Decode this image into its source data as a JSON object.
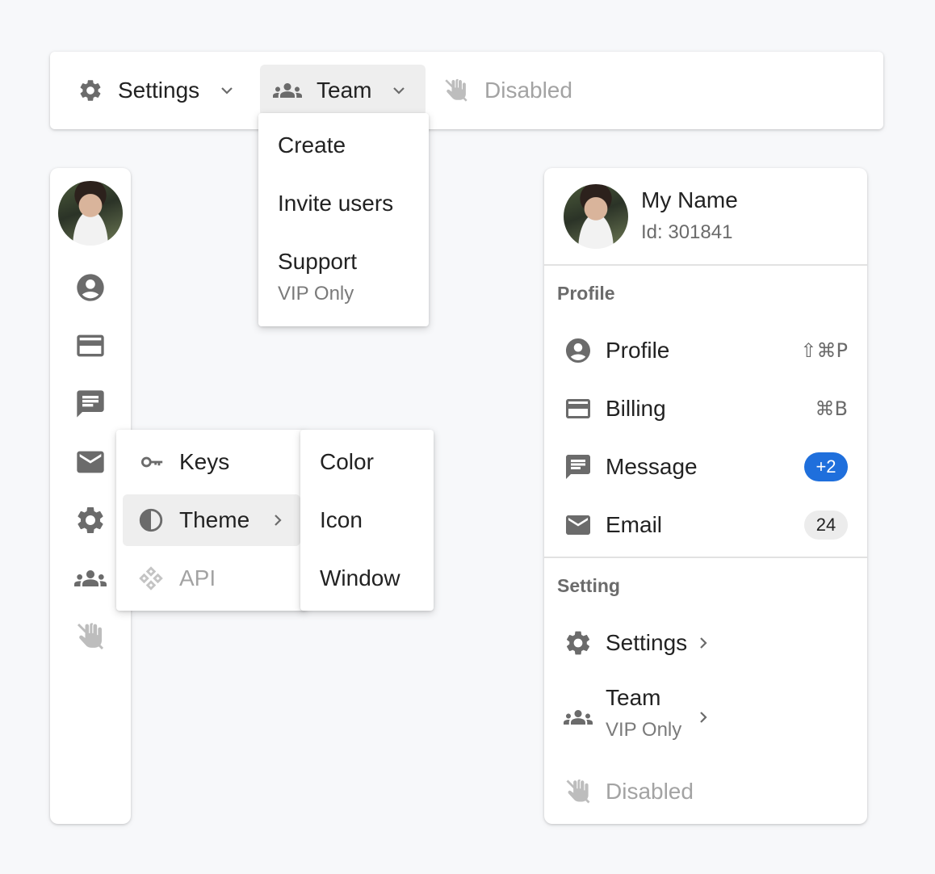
{
  "menubar": {
    "settings_label": "Settings",
    "team_label": "Team",
    "disabled_label": "Disabled"
  },
  "team_dropdown": {
    "items": [
      {
        "label": "Create"
      },
      {
        "label": "Invite users"
      },
      {
        "label": "Support",
        "sublabel": "VIP Only"
      }
    ]
  },
  "sidebar": {
    "icons": [
      "account-circle-icon",
      "credit-card-icon",
      "message-icon",
      "email-icon",
      "gear-icon",
      "team-icon",
      "hand-disabled-icon"
    ]
  },
  "sub_menu": {
    "items": [
      {
        "label": "Keys",
        "icon": "key-icon"
      },
      {
        "label": "Theme",
        "icon": "contrast-icon"
      },
      {
        "label": "API",
        "icon": "api-icon"
      }
    ]
  },
  "theme_menu": {
    "items": [
      {
        "label": "Color"
      },
      {
        "label": "Icon"
      },
      {
        "label": "Window"
      }
    ]
  },
  "profile_panel": {
    "name": "My Name",
    "id_text": "Id: 301841",
    "profile_section": {
      "title": "Profile",
      "items": [
        {
          "label": "Profile",
          "shortcut": "⇧⌘P"
        },
        {
          "label": "Billing",
          "shortcut": "⌘B"
        },
        {
          "label": "Message",
          "badge": "+2"
        },
        {
          "label": "Email",
          "badge": "24"
        }
      ]
    },
    "setting_section": {
      "title": "Setting",
      "items": [
        {
          "label": "Settings"
        },
        {
          "label": "Team",
          "sublabel": "VIP Only"
        },
        {
          "label": "Disabled"
        }
      ]
    }
  },
  "colors": {
    "accent_badge": "#1f6fdc",
    "icon_gray": "#6b6b6b",
    "disabled": "#a3a3a3",
    "selected_bg": "#eeeeee"
  }
}
